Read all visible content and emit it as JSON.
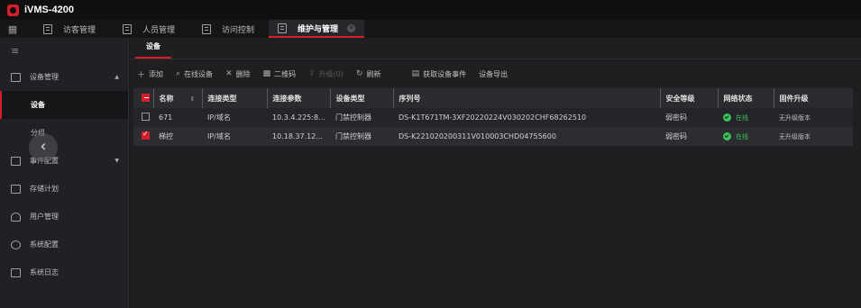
{
  "app": {
    "title": "iVMS-4200"
  },
  "tabs": [
    {
      "label": "访客管理"
    },
    {
      "label": "人员管理"
    },
    {
      "label": "访问控制"
    },
    {
      "label": "维护与管理"
    }
  ],
  "sidebar": {
    "items": [
      {
        "label": "设备管理"
      },
      {
        "label": "设备"
      },
      {
        "label": "分组"
      },
      {
        "label": "事件配置"
      },
      {
        "label": "存储计划"
      },
      {
        "label": "用户管理"
      },
      {
        "label": "系统配置"
      },
      {
        "label": "系统日志"
      }
    ]
  },
  "subtab": {
    "label": "设备"
  },
  "toolbar": {
    "add": "添加",
    "online_devices": "在线设备",
    "delete": "删除",
    "qrcode": "二维码",
    "upgrade": "升级(0)",
    "refresh": "刷新",
    "get_events": "获取设备事件",
    "export": "设备导出"
  },
  "table": {
    "headers": [
      "名称",
      "连接类型",
      "连接参数",
      "设备类型",
      "序列号",
      "安全等级",
      "网络状态",
      "固件升级"
    ],
    "rows": [
      {
        "name": "671",
        "conn_type": "IP/域名",
        "conn_param": "10.3.4.225:8...",
        "dev_type": "门禁控制器",
        "serial": "DS-K1T671TM-3XF20220224V030202CHF68262510",
        "security": "弱密码",
        "status": "在线",
        "firmware": "无升级版本",
        "checked": false
      },
      {
        "name": "梯控",
        "conn_type": "IP/域名",
        "conn_param": "10.18.37.12...",
        "dev_type": "门禁控制器",
        "serial": "DS-K221020200311V010003CHD04755600",
        "security": "弱密码",
        "status": "在线",
        "firmware": "无升级版本",
        "checked": true
      }
    ]
  },
  "colors": {
    "accent": "#d21f2a",
    "online": "#3ac45a"
  }
}
